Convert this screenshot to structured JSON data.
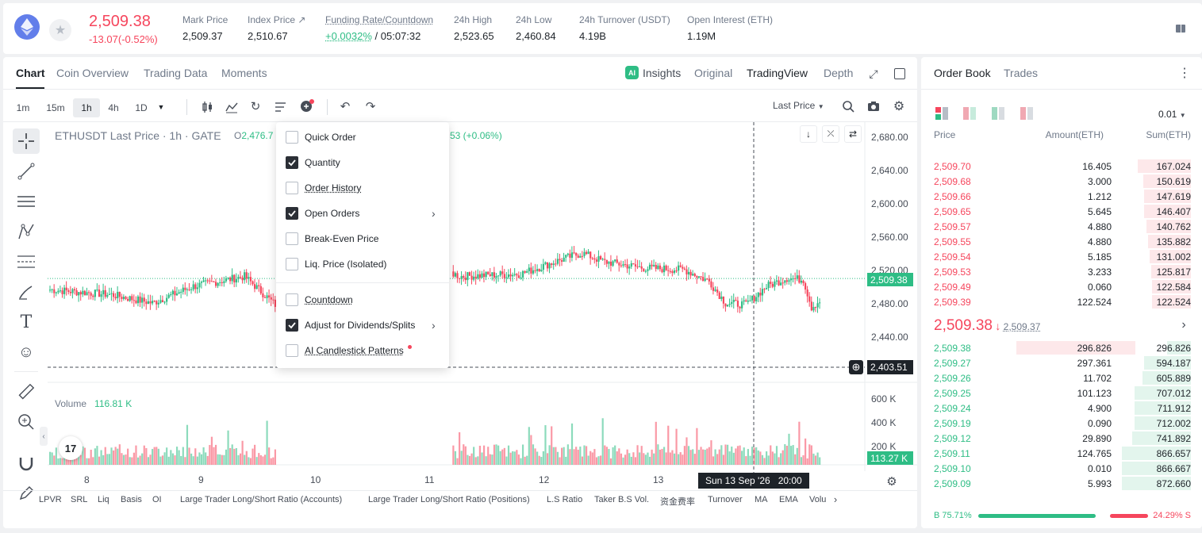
{
  "header": {
    "last_price": "2,509.38",
    "change": "-13.07(-0.52%)",
    "stats": [
      {
        "label": "Mark Price",
        "value": "2,509.37"
      },
      {
        "label": "Index Price ↗",
        "value": "2,510.67"
      },
      {
        "label": "Funding Rate/Countdown",
        "value_green": "+0.0032%",
        "value": " / 05:07:32"
      },
      {
        "label": "24h High",
        "value": "2,523.65"
      },
      {
        "label": "24h Low",
        "value": "2,460.84"
      },
      {
        "label": "24h Turnover (USDT)",
        "value": "4.19B"
      },
      {
        "label": "Open Interest (ETH)",
        "value": "1.19M"
      }
    ]
  },
  "chart_tabs": [
    "Chart",
    "Coin Overview",
    "Trading Data",
    "Moments"
  ],
  "view_tabs": {
    "insights": "Insights",
    "original": "Original",
    "tradingview": "TradingView",
    "depth": "Depth"
  },
  "intervals": [
    "1m",
    "15m",
    "1h",
    "4h",
    "1D"
  ],
  "price_type": "Last Price",
  "legend": {
    "symbol": "ETHUSDT Last Price · 1h · GATE",
    "o_label": "O",
    "o_value": "2,476.7",
    "change": "53 (+0.06%)"
  },
  "menu": {
    "items": [
      {
        "label": "Quick Order",
        "checked": false
      },
      {
        "label": "Quantity",
        "checked": true
      },
      {
        "label": "Order History",
        "checked": false
      },
      {
        "label": "Open Orders",
        "checked": true
      },
      {
        "label": "Break-Even Price",
        "checked": false
      },
      {
        "label": "Liq. Price (Isolated)",
        "checked": false
      },
      {
        "label": "Countdown",
        "checked": false
      },
      {
        "label": "Adjust for Dividends/Splits",
        "checked": true
      },
      {
        "label": "AI Candlestick Patterns",
        "checked": false
      }
    ]
  },
  "price_axis": [
    "2,680.00",
    "2,640.00",
    "2,600.00",
    "2,560.00",
    "2,520.00",
    "2,480.00",
    "2,440.00"
  ],
  "price_tags": {
    "current": "2,509.38",
    "cursor": "2,403.51",
    "volume": "113.27 K"
  },
  "volume": {
    "label": "Volume",
    "value": "116.81 K",
    "axis": [
      "600 K",
      "400 K",
      "200 K"
    ]
  },
  "time_axis": [
    "8",
    "9",
    "10",
    "11",
    "12",
    "13"
  ],
  "crosshair_time": "Sun 13 Sep '26   20:00",
  "indicators": [
    "LPVR",
    "SRL",
    "Liq",
    "Basis",
    "OI",
    "Large Trader Long/Short Ratio (Accounts)",
    "Large Trader Long/Short Ratio (Positions)",
    "L.S Ratio",
    "Taker B.S Vol.",
    "资金费率",
    "Turnover",
    "MA",
    "EMA",
    "Volu"
  ],
  "orderbook": {
    "tabs": [
      "Order Book",
      "Trades"
    ],
    "precision": "0.01",
    "cols": [
      "Price",
      "Amount(ETH)",
      "Sum(ETH)"
    ],
    "asks": [
      [
        "2,509.70",
        "16.405",
        "167.024"
      ],
      [
        "2,509.68",
        "3.000",
        "150.619"
      ],
      [
        "2,509.66",
        "1.212",
        "147.619"
      ],
      [
        "2,509.65",
        "5.645",
        "146.407"
      ],
      [
        "2,509.57",
        "4.880",
        "140.762"
      ],
      [
        "2,509.55",
        "4.880",
        "135.882"
      ],
      [
        "2,509.54",
        "5.185",
        "131.002"
      ],
      [
        "2,509.53",
        "3.233",
        "125.817"
      ],
      [
        "2,509.49",
        "0.060",
        "122.584"
      ],
      [
        "2,509.39",
        "122.524",
        "122.524"
      ]
    ],
    "mid_price": "2,509.38",
    "mid_arrow": "↓",
    "mid_mark": "2,509.37",
    "bids": [
      [
        "2,509.38",
        "296.826",
        "296.826"
      ],
      [
        "2,509.27",
        "297.361",
        "594.187"
      ],
      [
        "2,509.26",
        "11.702",
        "605.889"
      ],
      [
        "2,509.25",
        "101.123",
        "707.012"
      ],
      [
        "2,509.24",
        "4.900",
        "711.912"
      ],
      [
        "2,509.19",
        "0.090",
        "712.002"
      ],
      [
        "2,509.12",
        "29.890",
        "741.892"
      ],
      [
        "2,509.11",
        "124.765",
        "866.657"
      ],
      [
        "2,509.10",
        "0.010",
        "866.667"
      ],
      [
        "2,509.09",
        "5.993",
        "872.660"
      ]
    ],
    "buy_ratio": "B 75.71%",
    "sell_ratio": "24.29% S",
    "buy_pct": 75.71
  },
  "colors": {
    "green": "#2ebd85",
    "red": "#f6465d",
    "brand": "#627eea"
  }
}
